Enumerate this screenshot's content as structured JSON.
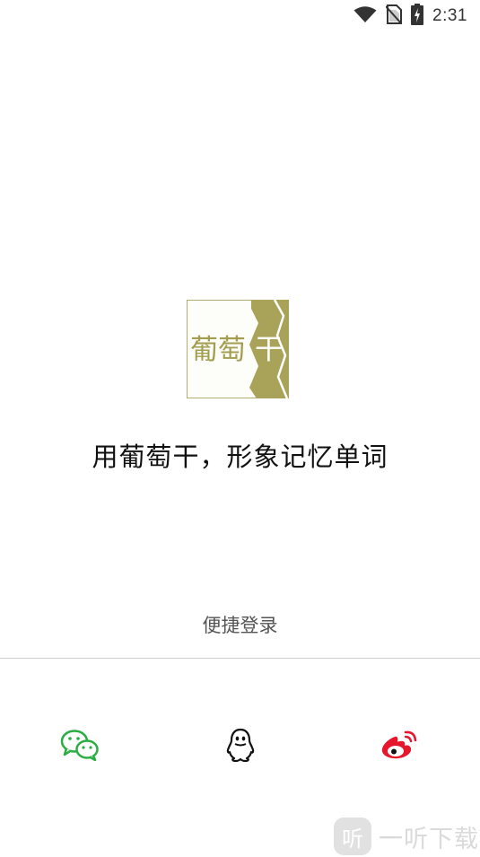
{
  "status_bar": {
    "time": "2:31",
    "icons": [
      "wifi-icon",
      "no-sim-icon",
      "battery-charging-icon"
    ]
  },
  "logo": {
    "text_left": "葡萄",
    "text_right": "干",
    "colors": {
      "frame": "#b5ad6e",
      "text": "#a39d4f",
      "panel": "#a8a358"
    }
  },
  "slogan": "用葡萄干，形象记忆单词",
  "quick_login": {
    "label": "便捷登录",
    "providers": [
      {
        "name": "wechat",
        "icon": "wechat-icon",
        "color": "#2aae42"
      },
      {
        "name": "qq",
        "icon": "qq-penguin-icon",
        "color": "#111111"
      },
      {
        "name": "weibo",
        "icon": "weibo-icon",
        "color": "#e6162d"
      }
    ]
  },
  "watermark": {
    "badge": "听",
    "text": "一听下载"
  }
}
